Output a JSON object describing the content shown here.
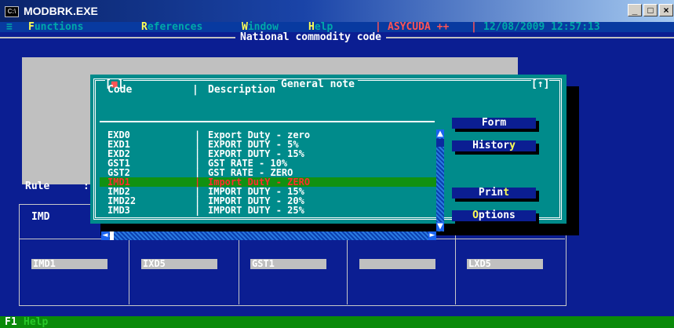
{
  "window": {
    "title": "MODBRK.EXE",
    "icon_text": "C:\\",
    "minimize": "_",
    "maximize": "□",
    "close": "×"
  },
  "menu": {
    "system": "≡",
    "items": [
      {
        "hotkey": "F",
        "rest": "unctions"
      },
      {
        "hotkey": "R",
        "rest": "eferences"
      },
      {
        "hotkey": "W",
        "rest": "indow"
      },
      {
        "hotkey": "H",
        "rest": "elp"
      }
    ],
    "separator": "|",
    "app_name": "ASYCUDA ++",
    "datetime": "12/08/2009 12:57:13"
  },
  "screen": {
    "title": "National commodity code",
    "rule_label": "Rule",
    "rule_colon": ":",
    "grid_header": "IMD",
    "fields": [
      "IMD1",
      "IXD5",
      "GST1",
      "",
      "LXD5"
    ]
  },
  "status": {
    "key": "F1",
    "label": "Help"
  },
  "dialog": {
    "title": "General note",
    "close_glyph": "■",
    "zoom_glyph": "↑",
    "columns": {
      "code": "Code",
      "sep": "|",
      "description": "Description"
    },
    "rows": [
      {
        "code": "EXD0",
        "description": "Export Duty - zero"
      },
      {
        "code": "EXD1",
        "description": "EXPORT DUTY - 5%"
      },
      {
        "code": "EXD2",
        "description": "EXPORT DUTY - 15%"
      },
      {
        "code": "GST1",
        "description": "GST RATE - 10%"
      },
      {
        "code": "GST2",
        "description": "GST RATE - ZERO"
      },
      {
        "code": "IMD1",
        "description": "Import DutY - ZERO"
      },
      {
        "code": "IMD2",
        "description": "IMPORT DUTY - 15%"
      },
      {
        "code": "IMD22",
        "description": "IMPORT DUTY - 20%"
      },
      {
        "code": "IMD3",
        "description": "IMPORT DUTY - 25%"
      }
    ],
    "selected_index": 5,
    "buttons": [
      {
        "hotkey": "",
        "label": "Form"
      },
      {
        "hotkey": "y",
        "label": "History"
      },
      {
        "hotkey": "t",
        "label": "Print"
      },
      {
        "hotkey": "O",
        "label": "Options"
      }
    ],
    "scroll": {
      "up": "▲",
      "down": "▼",
      "left": "◄",
      "right": "►"
    }
  },
  "colors": {
    "console_bg": "#0b1e92",
    "dialog_bg": "#008b8b",
    "selection_bg": "#119111",
    "selection_fg": "#ff2d2d",
    "hotkey": "#ffff54"
  }
}
